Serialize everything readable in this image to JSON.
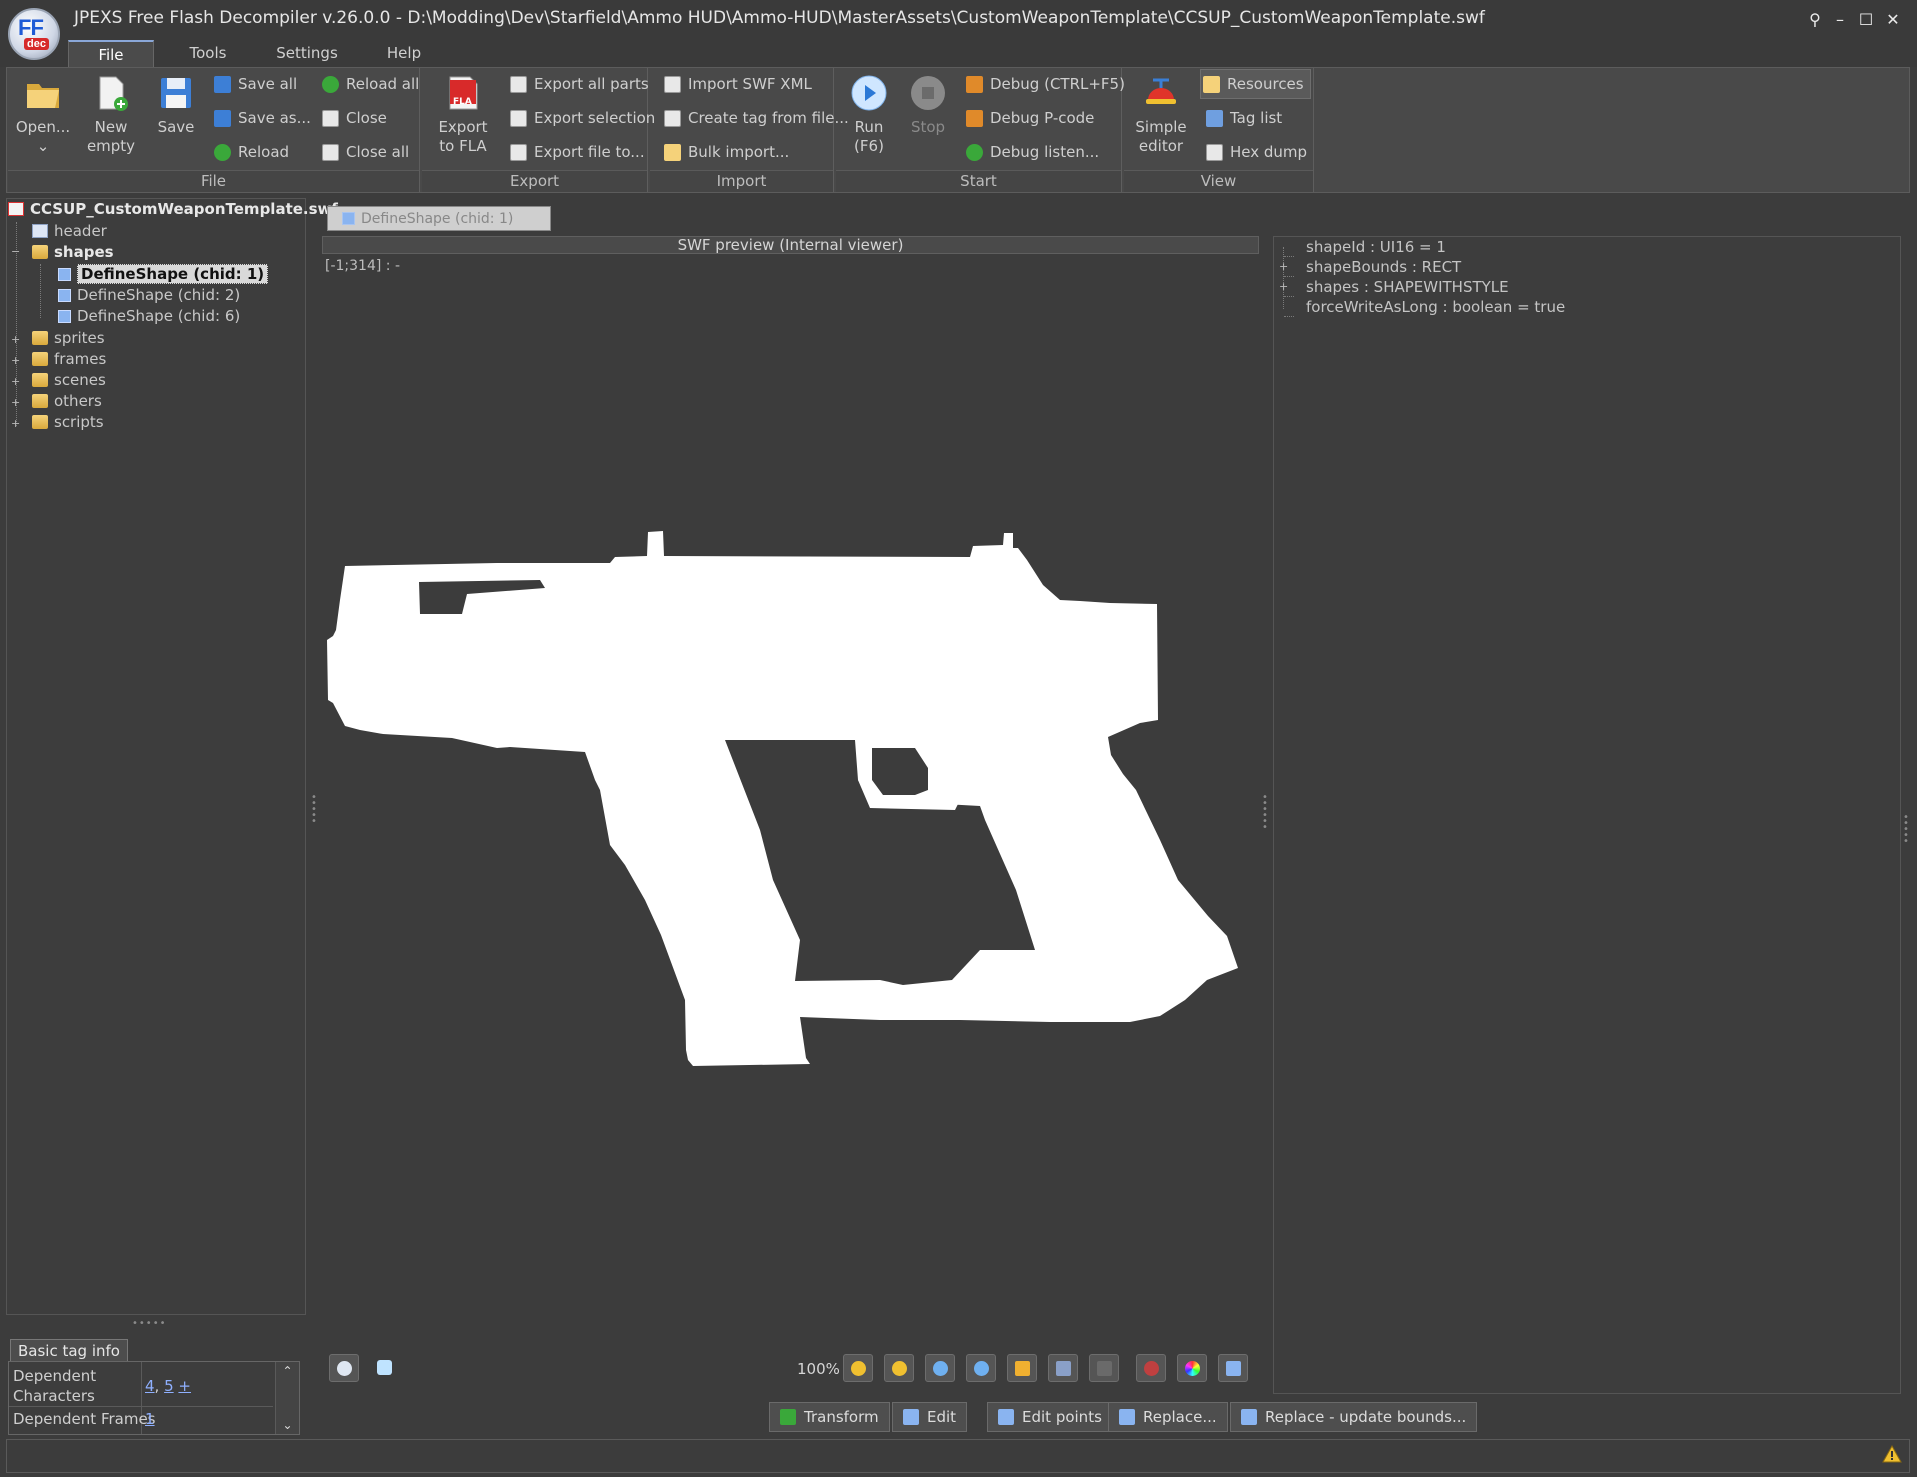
{
  "window": {
    "title": "JPEXS Free Flash Decompiler v.26.0.0 - D:\\Modding\\Dev\\Starfield\\Ammo HUD\\Ammo-HUD\\MasterAssets\\CustomWeaponTemplate\\CCSUP_CustomWeaponTemplate.swf",
    "logo_text": "FF",
    "logo_sub": "dec"
  },
  "menu": {
    "tabs": [
      "File",
      "Tools",
      "Settings",
      "Help"
    ],
    "active": "File"
  },
  "ribbon": {
    "file": {
      "label": "File",
      "open": "Open...",
      "new_line1": "New",
      "new_line2": "empty",
      "save": "Save",
      "save_all": "Save all",
      "save_as": "Save as...",
      "reload": "Reload",
      "reload_all": "Reload all",
      "close": "Close",
      "close_all": "Close all"
    },
    "export": {
      "label": "Export",
      "fla_line1": "Export",
      "fla_line2": "to FLA",
      "fla_badge": "FLA",
      "all_parts": "Export all parts",
      "selection": "Export selection",
      "file_to": "Export file to..."
    },
    "import": {
      "label": "Import",
      "swf_xml": "Import SWF XML",
      "create_tag": "Create tag from file...",
      "bulk": "Bulk import..."
    },
    "start": {
      "label": "Start",
      "run_line1": "Run",
      "run_line2": "(F6)",
      "stop": "Stop",
      "debug": "Debug (CTRL+F5)",
      "debug_pcode": "Debug P-code",
      "debug_listen": "Debug listen..."
    },
    "view": {
      "label": "View",
      "simple_line1": "Simple",
      "simple_line2": "editor",
      "resources": "Resources",
      "tag_list": "Tag list",
      "hex_dump": "Hex dump"
    }
  },
  "tree": {
    "root": "CCSUP_CustomWeaponTemplate.swf",
    "header": "header",
    "shapes": "shapes",
    "shape_items": [
      "DefineShape (chid: 1)",
      "DefineShape (chid: 2)",
      "DefineShape (chid: 6)"
    ],
    "folders": [
      "sprites",
      "frames",
      "scenes",
      "others",
      "scripts"
    ]
  },
  "taginfo": {
    "tab": "Basic tag info",
    "dep_chars_label_1": "Dependent",
    "dep_chars_label_2": "Characters",
    "dep_chars_a": "4",
    "dep_chars_b": "5",
    "dep_chars_plus": "+",
    "dep_frames_label": "Dependent Frames",
    "dep_frames_value": "1"
  },
  "preview": {
    "tab": "DefineShape (chid: 1)",
    "header": "SWF preview (Internal viewer)",
    "coords": "[-1;314] :  -",
    "zoom": "100%",
    "actions": [
      "Transform",
      "Edit",
      "Edit points",
      "Replace...",
      "Replace - update bounds..."
    ]
  },
  "properties": [
    "shapeId : UI16 = 1",
    "shapeBounds : RECT",
    "shapes : SHAPEWITHSTYLE",
    "forceWriteAsLong : boolean = true"
  ],
  "colors": {
    "background": "#3c3c3c",
    "accent": "#8aa7d8",
    "link": "#8fb0ff",
    "shape_fill": "#ffffff"
  }
}
